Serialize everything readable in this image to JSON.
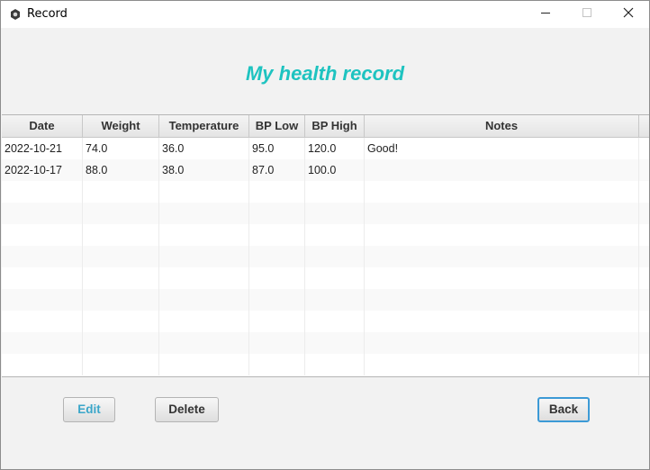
{
  "window": {
    "title": "Record",
    "icons": {
      "app": "app-icon",
      "minimize": "minimize-icon",
      "maximize": "maximize-icon",
      "close": "close-icon"
    }
  },
  "page": {
    "heading": "My health record",
    "heading_color": "#1ec3c0"
  },
  "table": {
    "columns": [
      "Date",
      "Weight",
      "Temperature",
      "BP Low",
      "BP High",
      "Notes"
    ],
    "rows": [
      [
        "2022-10-21",
        "74.0",
        "36.0",
        "95.0",
        "120.0",
        "Good!"
      ],
      [
        "2022-10-17",
        "88.0",
        "38.0",
        "87.0",
        "100.0",
        ""
      ],
      [
        "",
        "",
        "",
        "",
        "",
        ""
      ],
      [
        "",
        "",
        "",
        "",
        "",
        ""
      ],
      [
        "",
        "",
        "",
        "",
        "",
        ""
      ],
      [
        "",
        "",
        "",
        "",
        "",
        ""
      ],
      [
        "",
        "",
        "",
        "",
        "",
        ""
      ],
      [
        "",
        "",
        "",
        "",
        "",
        ""
      ],
      [
        "",
        "",
        "",
        "",
        "",
        ""
      ],
      [
        "",
        "",
        "",
        "",
        "",
        ""
      ],
      [
        "",
        "",
        "",
        "",
        "",
        ""
      ]
    ]
  },
  "buttons": {
    "edit": "Edit",
    "delete": "Delete",
    "back": "Back"
  },
  "colors": {
    "focus_border": "#3c9ad6",
    "edit_text": "#3aa6c9"
  }
}
